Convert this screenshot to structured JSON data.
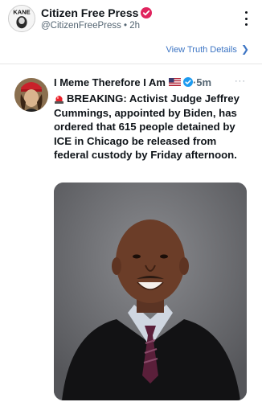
{
  "header": {
    "author_name": "Citizen Free Press",
    "author_meta": "@CitizenFreePress • 2h",
    "avatar_icon": "kane-logo",
    "avatar_lettering": "KANE",
    "verified_color": "#e0245e"
  },
  "truth_details": {
    "label": "View Truth Details",
    "icon": "chevron-right-icon"
  },
  "post": {
    "author": "I Meme Therefore I Am",
    "flag_icon": "us-flag-icon",
    "verified_color": "#1d9bf0",
    "time": "·5m",
    "more": "···",
    "siren_icon": "police-siren-emoji",
    "text": "BREAKING: Activist Judge Jeffrey Cummings, appointed by Biden, has ordered that 615 people detained by ICE in Chicago be released from federal custody by Friday afternoon.",
    "image_subject": "portrait-photo"
  }
}
